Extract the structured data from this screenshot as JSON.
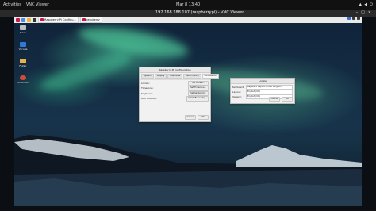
{
  "system_top_bar": {
    "activities": "Activities",
    "app_name": "VNC Viewer",
    "clock": "Mar 8  13:40"
  },
  "vnc_window": {
    "title": "192.168.188.107 (raspberrypi) - VNC Viewer"
  },
  "rpi_taskbar": {
    "apps": [
      {
        "label": "Raspberry Pi Configu..."
      },
      {
        "label": "raspberry"
      }
    ]
  },
  "desktop": {
    "icons": [
      {
        "label": "Trash"
      },
      {
        "label": "Vscode"
      },
      {
        "label": "Folder"
      },
      {
        "label": "Chromium"
      }
    ]
  },
  "config_dialog": {
    "title": "Raspberry Pi Configuration",
    "tabs": [
      "System",
      "Display",
      "Interfaces",
      "Performance",
      "Localisation"
    ],
    "rows": [
      {
        "label": "Locale:",
        "button": "Set Locale..."
      },
      {
        "label": "Timezone:",
        "button": "Set Timezone..."
      },
      {
        "label": "Keyboard:",
        "button": "Set Keyboard..."
      },
      {
        "label": "WiFi Country:",
        "button": "Set WiFi Country..."
      }
    ],
    "cancel": "Cancel",
    "ok": "OK"
  },
  "locale_dialog": {
    "title": "Locale",
    "rows": [
      {
        "label": "Keyboard:",
        "value": "Keyboard Layout United Kingdom"
      },
      {
        "label": "Layout:",
        "value": "English (UK)"
      },
      {
        "label": "Variant:",
        "value": "English (UK)"
      }
    ],
    "cancel": "Cancel",
    "ok": "OK"
  }
}
